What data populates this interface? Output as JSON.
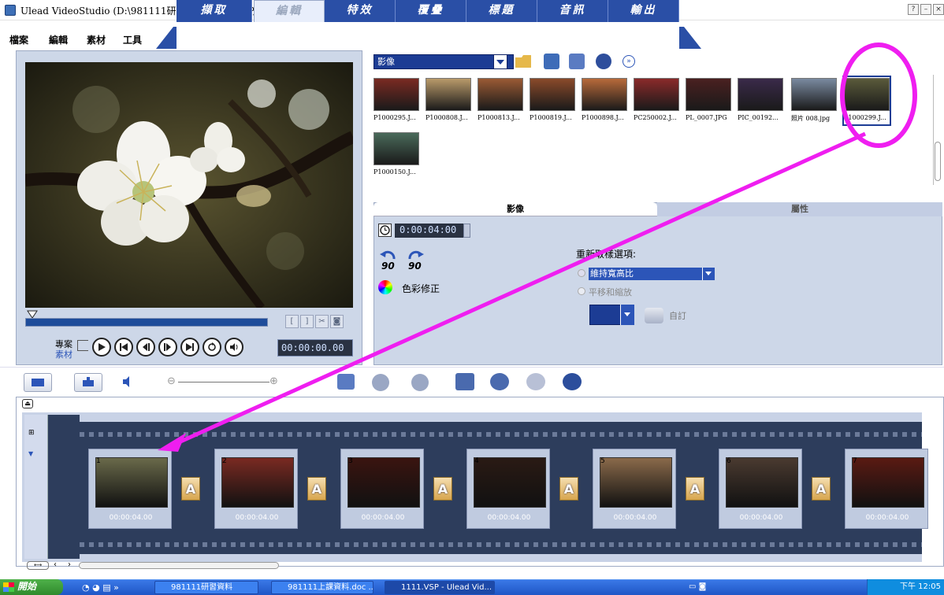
{
  "window": {
    "title": "Ulead VideoStudio (D:\\981111研習資料\\1111.VSP, DVD NTSC 720*480 - 立體聲)",
    "help_btn": "?",
    "min_btn": "–",
    "close_btn": "×"
  },
  "menu": [
    "檔案",
    "編輯",
    "素材",
    "工具"
  ],
  "steps": [
    "擷取",
    "編輯",
    "特效",
    "覆疊",
    "標題",
    "音訊",
    "輸出"
  ],
  "active_step": "編輯",
  "preview": {
    "timecode": "00:00:00.00",
    "mode_project": "專案",
    "mode_clip": "素材"
  },
  "library": {
    "category": "影像",
    "items": [
      {
        "label": "P1000295.J...",
        "color": "#7a2a22"
      },
      {
        "label": "P1000808.J...",
        "color": "#b99a6a"
      },
      {
        "label": "P1000813.J...",
        "color": "#9a5a34"
      },
      {
        "label": "P1000819.J...",
        "color": "#8a4a2a"
      },
      {
        "label": "P1000898.J...",
        "color": "#b86a3a"
      },
      {
        "label": "PC250002.J...",
        "color": "#8a2a2a"
      },
      {
        "label": "PL_0007.JPG",
        "color": "#4a2020"
      },
      {
        "label": "PIC_00192...",
        "color": "#3a2a4a"
      },
      {
        "label": "照片 008.jpg",
        "color": "#7a8aa0"
      },
      {
        "label": "P1000299.J...",
        "color": "#5a5a3a"
      },
      {
        "label": "P1000150.J...",
        "color": "#4a6a5a"
      }
    ]
  },
  "options": {
    "tab_image": "影像",
    "tab_attributes": "屬性",
    "duration": "0:00:04:00",
    "rotate_left": "90",
    "rotate_right": "90",
    "color_correction": "色彩修正",
    "resample_label": "重新取樣選項:",
    "resample_keep_ratio": "維持寬高比",
    "resample_pan_zoom": "平移和縮放",
    "custom": "自訂"
  },
  "timeline": {
    "clips": [
      {
        "num": "1",
        "duration": "00:00:04.00",
        "color": "#6a6a4a"
      },
      {
        "num": "2",
        "duration": "00:00:04.00",
        "color": "#7a2a22"
      },
      {
        "num": "3",
        "duration": "00:00:04.00",
        "color": "#3a1410"
      },
      {
        "num": "4",
        "duration": "00:00:04.00",
        "color": "#2a1a14"
      },
      {
        "num": "5",
        "duration": "00:00:04.00",
        "color": "#8a6a4a"
      },
      {
        "num": "6",
        "duration": "00:00:04.00",
        "color": "#4a3a30"
      },
      {
        "num": "7",
        "duration": "00:00:04.00",
        "color": "#5a1a12"
      }
    ],
    "transition_label": "A"
  },
  "taskbar": {
    "start": "開始",
    "tasks": [
      "981111研習資料",
      "981111上課資料.doc ...",
      "1111.VSP - Ulead Vid..."
    ],
    "clock": "下午 12:05"
  }
}
